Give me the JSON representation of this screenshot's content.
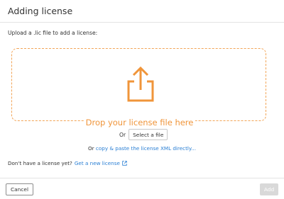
{
  "dialog": {
    "title": "Adding license",
    "upload_label": "Upload a .lic file to add a license:",
    "dropzone": {
      "icon": "share-upload-icon",
      "text": "Drop your license file here",
      "accent": "#f0953a"
    },
    "or_text": "Or",
    "select_file_label": "Select a file",
    "paste_prefix": "Or",
    "paste_link": "copy & paste the license XML directly...",
    "no_license_text": "Don't have a license yet?",
    "get_license_link": "Get a new license",
    "external_icon": "external-link-icon",
    "link_color": "#2a7fd4"
  },
  "footer": {
    "cancel_label": "Cancel",
    "add_label": "Add"
  }
}
